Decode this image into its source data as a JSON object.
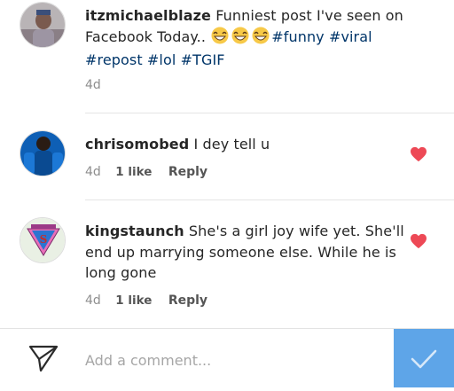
{
  "comments": [
    {
      "username": "itzmichaelblaze",
      "text_lead": "Funniest post I've seen on Facebook Today..",
      "emojis": [
        "grinning",
        "grinning",
        "grinning"
      ],
      "hashtags": [
        "#funny",
        "#viral",
        "#repost",
        "#lol",
        "#TGIF"
      ],
      "time": "4d"
    },
    {
      "username": "chrisomobed",
      "text": "I dey tell u",
      "time": "4d",
      "likes": "1 like",
      "reply_label": "Reply",
      "liked": true
    },
    {
      "username": "kingstaunch",
      "text": "She's a girl joy wife yet. She'll end up marrying someone else. While he is long gone",
      "time": "4d",
      "likes": "1 like",
      "reply_label": "Reply",
      "liked": true
    }
  ],
  "composer": {
    "placeholder": "Add a comment...",
    "send_icon": "paper-plane-icon",
    "post_icon": "checkmark-icon",
    "post_button_color": "#5ea5e8"
  },
  "colors": {
    "heart": "#ed4956",
    "hashtag": "#003569"
  }
}
